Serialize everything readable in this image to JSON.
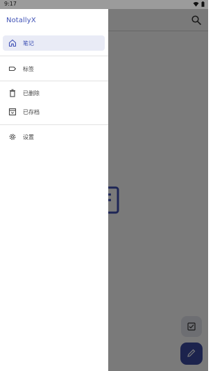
{
  "status_bar": {
    "time": "9:17"
  },
  "app": {
    "title": "NotallyX"
  },
  "drawer": {
    "title": "NotallyX",
    "items": [
      {
        "label": "笔记",
        "icon": "home-icon",
        "active": true
      },
      {
        "label": "标签",
        "icon": "label-icon",
        "active": false
      },
      {
        "label": "已删除",
        "icon": "trash-icon",
        "active": false
      },
      {
        "label": "已存档",
        "icon": "archive-icon",
        "active": false
      },
      {
        "label": "设置",
        "icon": "gear-icon",
        "active": false
      }
    ]
  },
  "colors": {
    "accent": "#3f51b5",
    "active_bg": "#e9ebf6",
    "fab": "#3b4aa1",
    "scrim": "rgba(0,0,0,0.52)"
  }
}
